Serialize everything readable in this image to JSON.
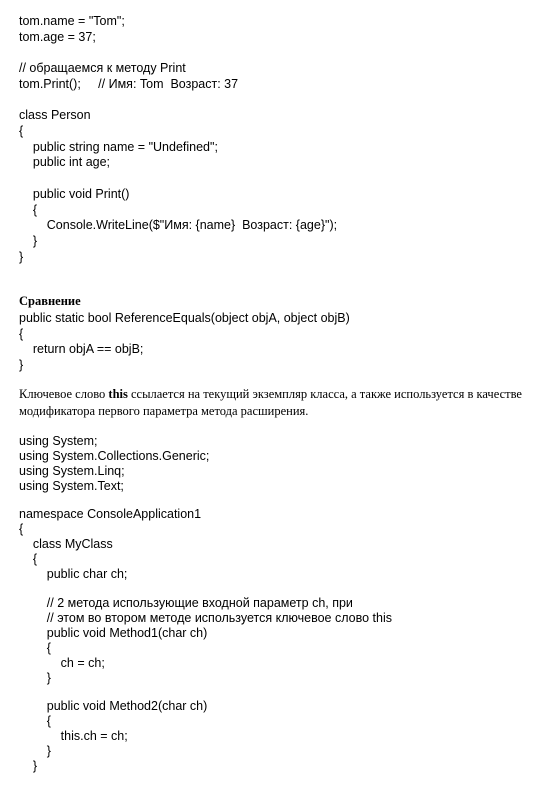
{
  "snippet1": [
    "tom.name = \"Tom\";",
    "tom.age = 37;",
    "",
    "// обращаемся к методу Print",
    "tom.Print();     // Имя: Tom  Возраст: 37"
  ],
  "snippet2": [
    "class Person",
    "{",
    "    public string name = \"Undefined\";",
    "    public int age;",
    "",
    "    public void Print()",
    "    {",
    "        Console.WriteLine($\"Имя: {name}  Возраст: {age}\");",
    "    }",
    "}"
  ],
  "comparison": {
    "heading": "Сравнение",
    "code": [
      "public static bool ReferenceEquals(object objA, object objB)",
      "{",
      "    return objA == objB;",
      "}"
    ]
  },
  "paragraph": {
    "before": "Ключевое слово ",
    "keyword": "this",
    "after": " ссылается на текущий экземпляр класса, а также используется в качестве модификатора первого параметра метода расширения."
  },
  "snippet3": [
    "using System;",
    "using System.Collections.Generic;",
    "using System.Linq;",
    "using System.Text;",
    "",
    "namespace ConsoleApplication1",
    "{",
    "    class MyClass",
    "    {",
    "        public char ch;",
    "",
    "        // 2 метода использующие входной параметр ch, при",
    "        // этом во втором методе используется ключевое слово this",
    "        public void Method1(char ch)",
    "        {",
    "            ch = ch;",
    "        }",
    "",
    "        public void Method2(char ch)",
    "        {",
    "            this.ch = ch;",
    "        }",
    "    }"
  ]
}
